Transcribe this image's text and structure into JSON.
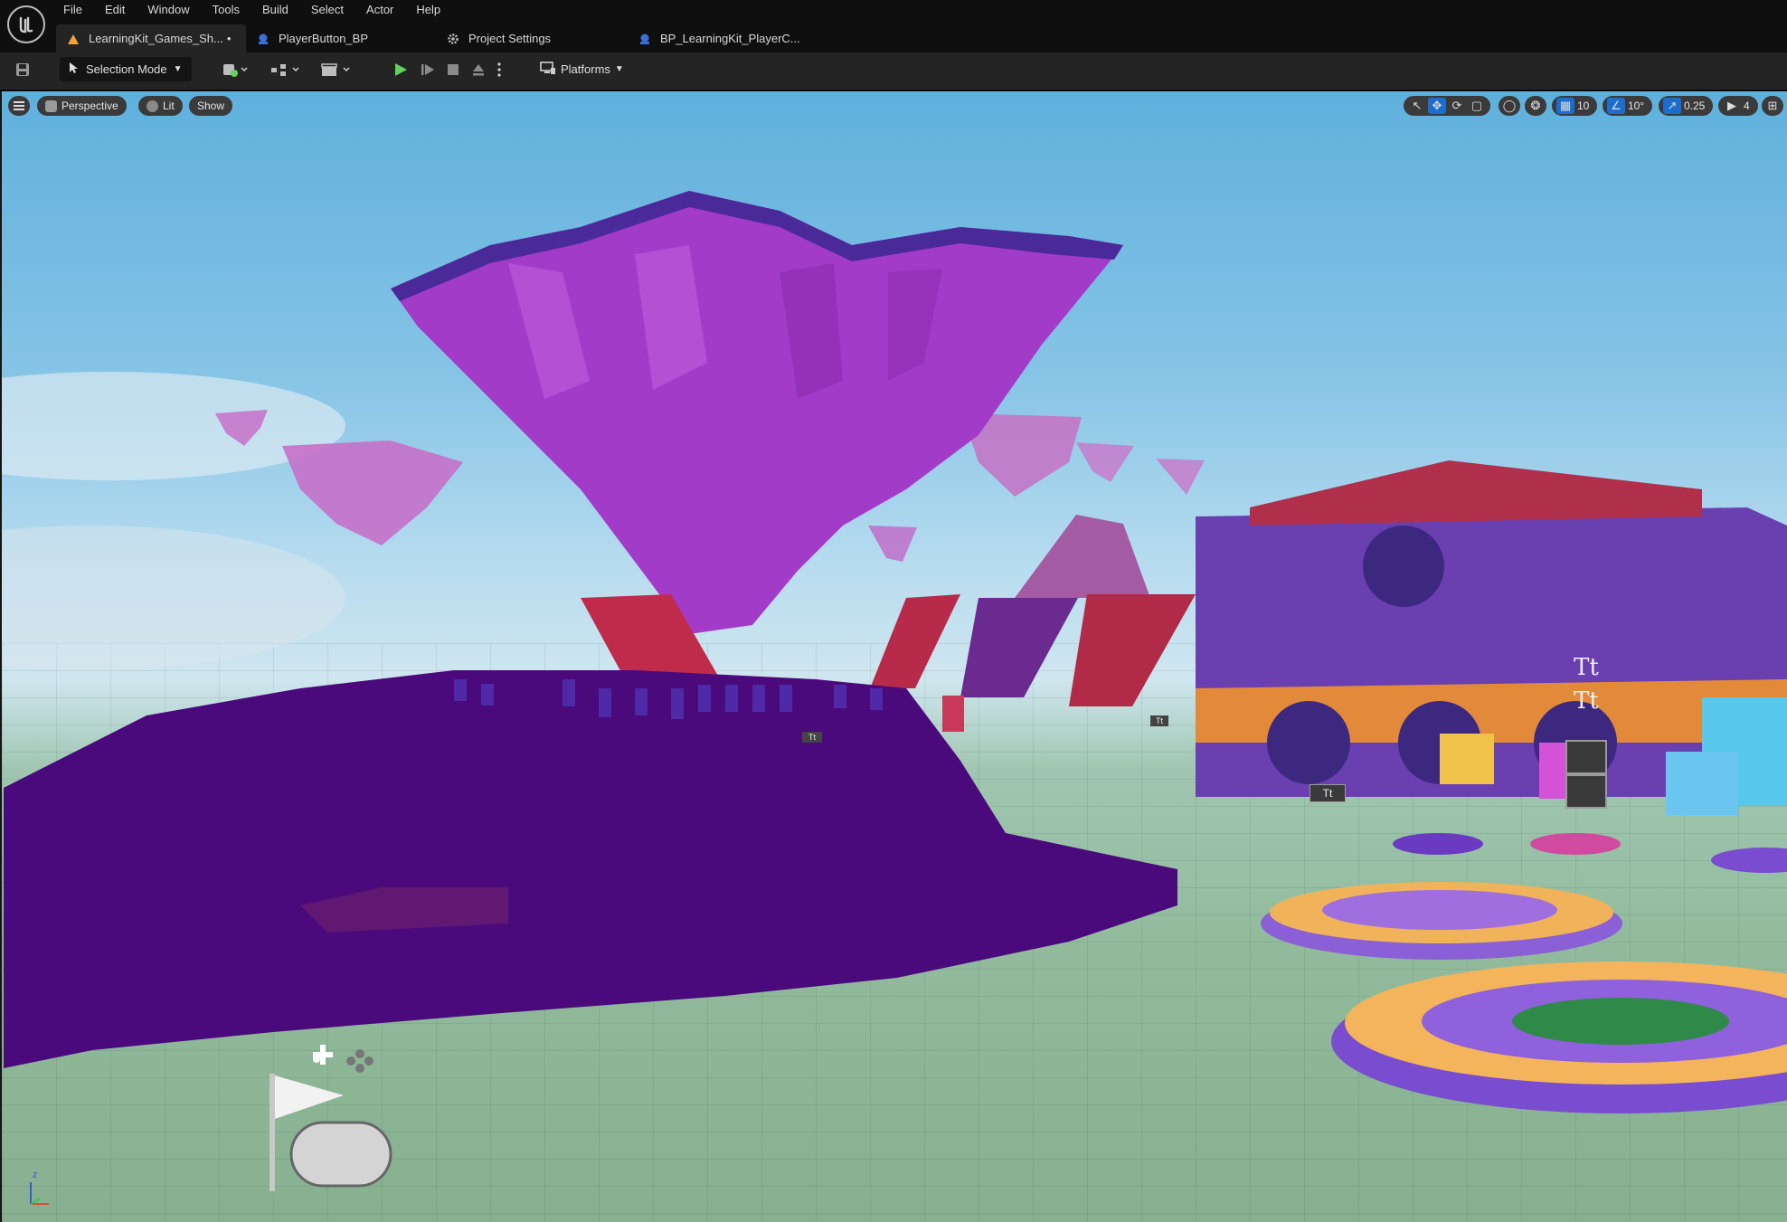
{
  "menu": {
    "items": [
      "File",
      "Edit",
      "Window",
      "Tools",
      "Build",
      "Select",
      "Actor",
      "Help"
    ]
  },
  "tabs": [
    {
      "label": "LearningKit_Games_Sh...",
      "modified": "•"
    },
    {
      "label": "PlayerButton_BP"
    },
    {
      "label": "Project Settings"
    },
    {
      "label": "BP_LearningKit_PlayerC..."
    }
  ],
  "toolbar": {
    "selection_mode": "Selection Mode",
    "platforms": "Platforms"
  },
  "viewport": {
    "perspective": "Perspective",
    "lit": "Lit",
    "show": "Show",
    "grid_snap": "10",
    "rotation_snap": "10°",
    "scale_snap": "0.25",
    "camera_speed": "4",
    "text_render_glyph": "Tt",
    "axis_z": "z"
  },
  "colors": {
    "accent": "#1b6ed0",
    "play_green": "#5fd35a",
    "magenta": "#a33bc9",
    "purple_ground": "#4a0a7c"
  }
}
